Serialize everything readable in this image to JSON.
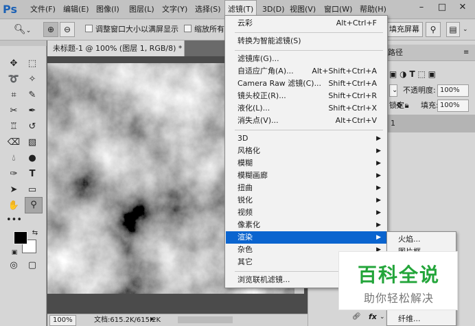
{
  "menubar": {
    "logo": "Ps",
    "items": [
      "文件(F)",
      "编辑(E)",
      "图像(I)",
      "图层(L)",
      "文字(Y)",
      "选择(S)",
      "滤镜(T)",
      "3D(D)",
      "视图(V)",
      "窗口(W)",
      "帮助(H)"
    ],
    "active": "滤镜(T)",
    "window_controls": [
      "–",
      "□",
      "✕"
    ]
  },
  "options": {
    "resize_windows": "调整窗口大小以满屏显示",
    "zoom_all": "缩放所有",
    "fill_screen": "填充屏幕"
  },
  "document": {
    "tab_title": "未标题-1 @ 100% (图层 1, RGB/8) *",
    "tab_close": "×",
    "zoom_value": "100%",
    "doc_info": "文档:615.2K/615.2K"
  },
  "panels": {
    "tab_label": "路径",
    "opacity_label": "不透明度:",
    "opacity_value": "100%",
    "lock_label": "锁定:",
    "fill_label": "填充:",
    "fill_value": "100%",
    "layer_number": "1",
    "fx_label": "fx"
  },
  "filter_menu": {
    "items": [
      {
        "label": "云彩",
        "shortcut": "Alt+Ctrl+F"
      },
      {
        "label": "转换为智能滤镜(S)",
        "shortcut": ""
      },
      {
        "label": "滤镜库(G)...",
        "shortcut": ""
      },
      {
        "label": "自适应广角(A)...",
        "shortcut": "Alt+Shift+Ctrl+A"
      },
      {
        "label": "Camera Raw 滤镜(C)...",
        "shortcut": "Shift+Ctrl+A"
      },
      {
        "label": "镜头校正(R)...",
        "shortcut": "Shift+Ctrl+R"
      },
      {
        "label": "液化(L)...",
        "shortcut": "Shift+Ctrl+X"
      },
      {
        "label": "消失点(V)...",
        "shortcut": "Alt+Ctrl+V"
      },
      {
        "label": "3D",
        "submenu": true
      },
      {
        "label": "风格化",
        "submenu": true
      },
      {
        "label": "模糊",
        "submenu": true
      },
      {
        "label": "模糊画廊",
        "submenu": true
      },
      {
        "label": "扭曲",
        "submenu": true
      },
      {
        "label": "锐化",
        "submenu": true
      },
      {
        "label": "视频",
        "submenu": true
      },
      {
        "label": "像素化",
        "submenu": true
      },
      {
        "label": "渲染",
        "submenu": true,
        "highlighted": true
      },
      {
        "label": "杂色",
        "submenu": true
      },
      {
        "label": "其它",
        "submenu": true
      },
      {
        "label": "浏览联机滤镜...",
        "shortcut": ""
      }
    ]
  },
  "render_submenu": {
    "items": [
      "火焰...",
      "图片框...",
      "纤维..."
    ]
  },
  "watermark": {
    "title": "百科全说",
    "subtitle": "助你轻松解决"
  },
  "colors": {
    "highlight": "#0a64cf",
    "watermark_green": "#23a53a",
    "ps_blue": "#1c61b5"
  }
}
